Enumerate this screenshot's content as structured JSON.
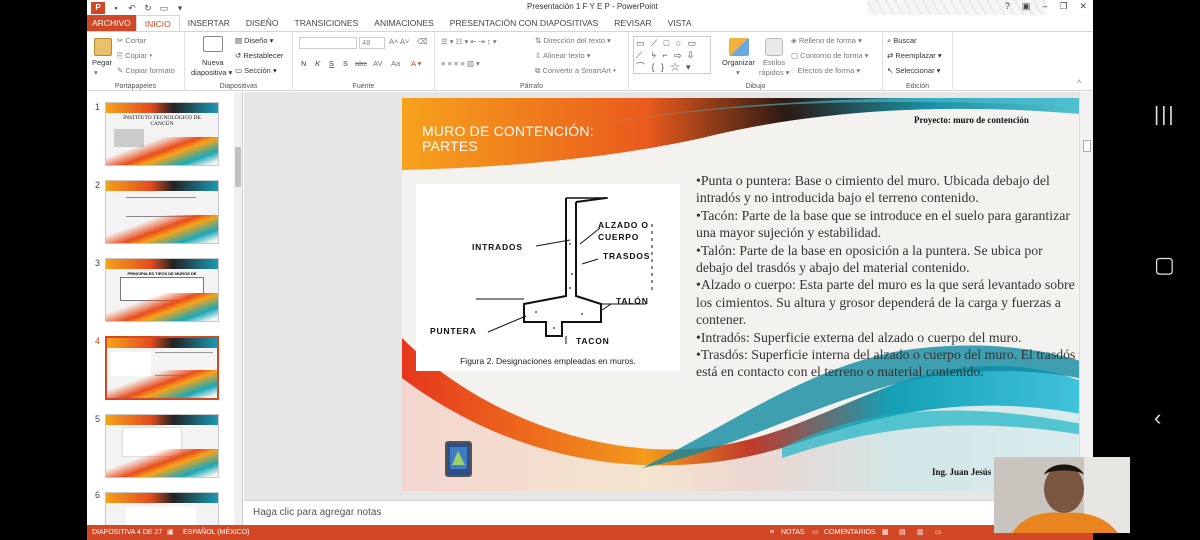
{
  "window": {
    "title": "Presentación 1 F Y E P - PowerPoint",
    "controls": [
      "?",
      "▣",
      "–",
      "❐",
      "✕"
    ]
  },
  "tabs": [
    "ARCHIVO",
    "INICIO",
    "INSERTAR",
    "DISEÑO",
    "TRANSICIONES",
    "ANIMACIONES",
    "PRESENTACIÓN CON DIAPOSITIVAS",
    "REVISAR",
    "VISTA"
  ],
  "active_tab": "INICIO",
  "ribbon": {
    "portapapeles": {
      "label": "Portapapeles",
      "paste": "Pegar",
      "cut": "Cortar",
      "copy": "Copiar",
      "format_painter": "Copiar formato"
    },
    "diapositivas": {
      "label": "Diapositivas",
      "new_slide": "Nueva diapositiva",
      "layout": "Diseño",
      "reset": "Restablecer",
      "section": "Sección"
    },
    "fuente": {
      "label": "Fuente",
      "size": "48",
      "buttons": [
        "N",
        "K",
        "S",
        "S",
        "abc",
        "AV",
        "Aa"
      ]
    },
    "parrafo": {
      "label": "Párrafo",
      "direction": "Dirección del texto",
      "align": "Alinear texto",
      "smartart": "Convertir a SmartArt"
    },
    "dibujo": {
      "label": "Dibujo",
      "arrange": "Organizar",
      "styles": "Estilos rápidos",
      "fill": "Relleno de forma",
      "outline": "Contorno de forma",
      "effects": "Efectos de forma"
    },
    "edicion": {
      "label": "Edición",
      "find": "Buscar",
      "replace": "Reemplazar",
      "select": "Seleccionar"
    }
  },
  "thumbnails": [
    {
      "num": "1",
      "title": "INSTITUTO TECNOLÓGICO DE CANCÚN"
    },
    {
      "num": "2",
      "title": ""
    },
    {
      "num": "3",
      "title": "PRINCIPALES TIPOS DE MUROS DE CONTENCIÓN"
    },
    {
      "num": "4",
      "title": ""
    },
    {
      "num": "5",
      "title": ""
    },
    {
      "num": "6",
      "title": ""
    }
  ],
  "slide": {
    "title_line1": "MURO DE CONTENCIÓN:",
    "title_line2": "PARTES",
    "project": "Proyecto: muro de contención",
    "figure_caption": "Figura 2. Designaciones empleadas en muros.",
    "figure_labels": {
      "alzado1": "ALZADO O",
      "alzado2": "CUERPO",
      "intrados": "INTRADOS",
      "trasdos": "TRASDOS",
      "talon": "TALÓN",
      "puntera": "PUNTERA",
      "tacon": "TACON"
    },
    "bullets": [
      "•Punta o puntera: Base o cimiento del muro. Ubicada debajo del intradós y no introducida bajo el terreno contenido.",
      "•Tacón: Parte de la base que se introduce en el suelo para garantizar una mayor sujeción y estabilidad.",
      "•Talón: Parte de la base en oposición a la puntera. Se ubica por debajo del trasdós y abajo del material contenido.",
      "•Alzado o cuerpo: Esta parte del muro es la que será levantado sobre los cimientos. Su altura y grosor dependerá de la carga y fuerzas a contener.",
      "•Intradós: Superficie externa del alzado o cuerpo del muro.",
      "•Trasdós: Superficie interna del alzado o cuerpo del muro. El trasdós está en contacto con el terreno o material contenido."
    ],
    "author": "Ing. Juan Jesús Zubiran Ortiz"
  },
  "notes_placeholder": "Haga clic para agregar notas",
  "status": {
    "slide_info": "DIAPOSITIVA 4 DE 27",
    "language": "ESPAÑOL (MÉXICO)",
    "notes": "NOTAS",
    "comments": "COMENTARIOS"
  },
  "colors": {
    "accent": "#d24726",
    "teal": "#1ba8b5",
    "orange": "#f39c1e"
  }
}
